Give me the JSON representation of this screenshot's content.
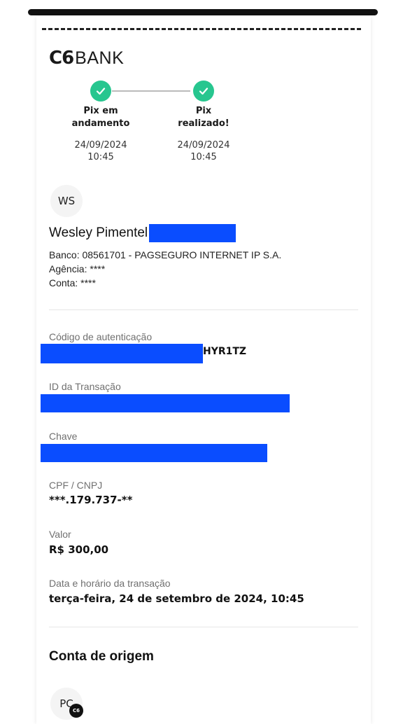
{
  "logo": {
    "mark": "C6",
    "word": "BANK"
  },
  "steps": [
    {
      "title_line1": "Pix em",
      "title_line2": "andamento",
      "date": "24/09/2024",
      "time": "10:45"
    },
    {
      "title_line1": "Pix",
      "title_line2": "realizado!",
      "date": "24/09/2024",
      "time": "10:45"
    }
  ],
  "recipient": {
    "initials": "WS",
    "name": "Wesley Pimentel",
    "bank": "Banco: 08561701 - PAGSEGURO INTERNET IP S.A.",
    "agency": "Agência: ****",
    "account": "Conta: ****"
  },
  "fields": {
    "auth_label": "Código de autenticação",
    "auth_value_visible": "HYR1TZ",
    "transaction_label": "ID da Transação",
    "key_label": "Chave",
    "cpf_label": "CPF / CNPJ",
    "cpf_value": "***.179.737-**",
    "amount_label": "Valor",
    "amount_value": "R$ 300,00",
    "datetime_label": "Data e horário da transação",
    "datetime_value": "terça-feira, 24 de setembro de 2024, 10:45"
  },
  "origin": {
    "title": "Conta de origem",
    "initials": "PC",
    "badge": "C6"
  },
  "colors": {
    "success": "#27c68f",
    "redaction": "#0a4dff"
  },
  "icons": [
    "check-icon"
  ]
}
